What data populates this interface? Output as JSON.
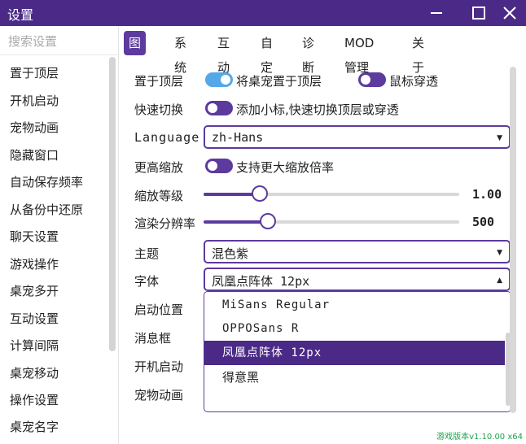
{
  "window": {
    "title": "设置"
  },
  "sidebar": {
    "search_placeholder": "搜索设置",
    "items": [
      "置于顶层",
      "开机启动",
      "宠物动画",
      "隐藏窗口",
      "自动保存频率",
      "从备份中还原",
      "聊天设置",
      "游戏操作",
      "桌宠多开",
      "互动设置",
      "计算间隔",
      "桌宠移动",
      "操作设置",
      "桌宠名字"
    ]
  },
  "tabs": [
    {
      "label": "图形",
      "active": true
    },
    {
      "label": "系统",
      "active": false
    },
    {
      "label": "互动",
      "active": false
    },
    {
      "label": "自定",
      "active": false
    },
    {
      "label": "诊断",
      "active": false
    },
    {
      "label": "MOD管理",
      "active": false
    },
    {
      "label": "关于",
      "active": false
    }
  ],
  "settings": {
    "topmost": {
      "label": "置于顶层",
      "toggle1": {
        "text": "将桌宠置于顶层",
        "on": true
      },
      "toggle2": {
        "text": "鼠标穿透",
        "on": false
      }
    },
    "quick_switch": {
      "label": "快速切换",
      "toggle": {
        "text": "添加小标,快速切换顶层或穿透",
        "on": false
      }
    },
    "language": {
      "label": "Language",
      "value": "zh-Hans"
    },
    "higher_zoom": {
      "label": "更高缩放",
      "toggle": {
        "text": "支持更大缩放倍率",
        "on": false
      }
    },
    "zoom_level": {
      "label": "缩放等级",
      "value": "1.00",
      "fraction": 0.22
    },
    "render_resolution": {
      "label": "渲染分辨率",
      "value": "500",
      "fraction": 0.25
    },
    "theme": {
      "label": "主题",
      "value": "混色紫"
    },
    "font": {
      "label": "字体",
      "value": "凤凰点阵体 12px",
      "options": [
        "MiSans Regular",
        "OPPOSans R",
        "凤凰点阵体 12px",
        "得意黑"
      ],
      "selected_index": 2
    },
    "startup_position": {
      "label": "启动位置"
    },
    "message_box": {
      "label": "消息框"
    },
    "boot_start": {
      "label": "开机启动"
    },
    "pet_animation": {
      "label": "宠物动画"
    }
  },
  "footer": {
    "version": "游戏版本v1.10.00 x64"
  },
  "colors": {
    "accent": "#5c3a9e",
    "titlebar": "#4a2a86",
    "toggle_on": "#55a8e8",
    "version_text": "#1aa34a"
  },
  "icons": [
    "minimize-icon",
    "maximize-icon",
    "close-icon",
    "chevron-down-icon",
    "chevron-up-icon"
  ]
}
